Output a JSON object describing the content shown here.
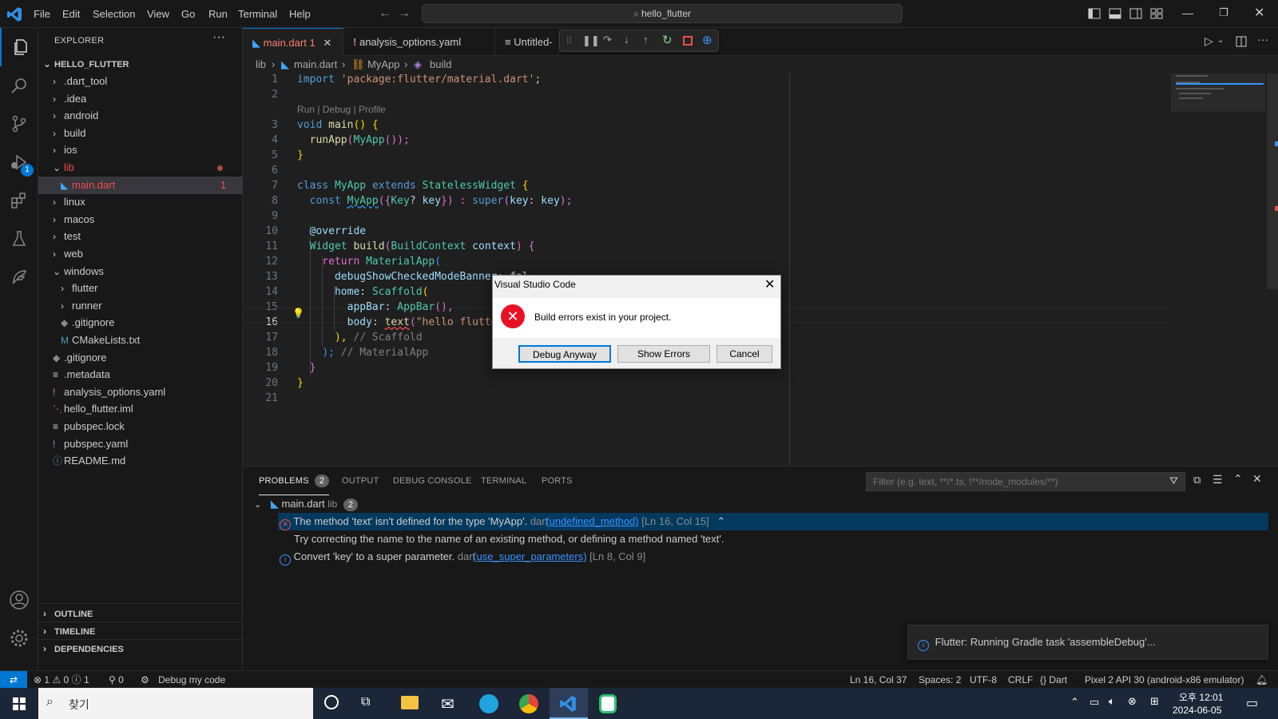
{
  "titlebar": {
    "menus": [
      "File",
      "Edit",
      "Selection",
      "View",
      "Go",
      "Run",
      "Terminal",
      "Help"
    ],
    "search": "hello_flutter"
  },
  "activity": {
    "debug_badge": "1"
  },
  "explorer": {
    "header": "EXPLORER",
    "root": "HELLO_FLUTTER",
    "items": [
      {
        "label": ".dart_tool",
        "indent": 0,
        "kind": "folder"
      },
      {
        "label": ".idea",
        "indent": 0,
        "kind": "folder"
      },
      {
        "label": "android",
        "indent": 0,
        "kind": "folder"
      },
      {
        "label": "build",
        "indent": 0,
        "kind": "folder"
      },
      {
        "label": "ios",
        "indent": 0,
        "kind": "folder"
      },
      {
        "label": "lib",
        "indent": 0,
        "kind": "folder-open"
      },
      {
        "label": "main.dart",
        "indent": 1,
        "kind": "dart"
      },
      {
        "label": "linux",
        "indent": 0,
        "kind": "folder"
      },
      {
        "label": "macos",
        "indent": 0,
        "kind": "folder"
      },
      {
        "label": "test",
        "indent": 0,
        "kind": "folder"
      },
      {
        "label": "web",
        "indent": 0,
        "kind": "folder"
      },
      {
        "label": "windows",
        "indent": 0,
        "kind": "folder-open"
      },
      {
        "label": "flutter",
        "indent": 1,
        "kind": "folder"
      },
      {
        "label": "runner",
        "indent": 1,
        "kind": "folder"
      },
      {
        "label": ".gitignore",
        "indent": 1,
        "kind": "git"
      },
      {
        "label": "CMakeLists.txt",
        "indent": 1,
        "kind": "cmake"
      },
      {
        "label": ".gitignore",
        "indent": 0,
        "kind": "git"
      },
      {
        "label": ".metadata",
        "indent": 0,
        "kind": "lines"
      },
      {
        "label": "analysis_options.yaml",
        "indent": 0,
        "kind": "yaml"
      },
      {
        "label": "hello_flutter.iml",
        "indent": 0,
        "kind": "rss"
      },
      {
        "label": "pubspec.lock",
        "indent": 0,
        "kind": "lines"
      },
      {
        "label": "pubspec.yaml",
        "indent": 0,
        "kind": "yaml"
      },
      {
        "label": "README.md",
        "indent": 0,
        "kind": "info"
      }
    ],
    "main_dart_badge": "1",
    "sections": [
      "OUTLINE",
      "TIMELINE",
      "DEPENDENCIES"
    ]
  },
  "tabs": [
    {
      "label": "main.dart",
      "badge": "1"
    },
    {
      "label": "analysis_options.yaml"
    },
    {
      "label": "Untitled-"
    }
  ],
  "breadcrumb": [
    "lib",
    "main.dart",
    "MyApp",
    "build"
  ],
  "codelens": "Run | Debug | Profile",
  "code_line_numbers": [
    "1",
    "2",
    "",
    "3",
    "4",
    "5",
    "6",
    "7",
    "8",
    "9",
    "10",
    "11",
    "12",
    "13",
    "14",
    "15",
    "16",
    "17",
    "18",
    "19",
    "20",
    "21"
  ],
  "code": {
    "l1a": "import ",
    "l1b": "'package:flutter/material.dart'",
    "l1c": ";",
    "l3a": "void ",
    "l3b": "main",
    "l3c": "() {",
    "l4a": "  ",
    "l4b": "runApp",
    "l4c": "(",
    "l4d": "MyApp",
    "l4e": "());",
    "l5": "}",
    "l7a": "class ",
    "l7b": "MyApp ",
    "l7c": "extends ",
    "l7d": "StatelessWidget ",
    "l7e": "{",
    "l8a": "  const ",
    "l8b": "MyApp",
    "l8c": "({",
    "l8d": "Key",
    "l8e": "? ",
    "l8f": "key",
    "l8g": "}) : ",
    "l8h": "super",
    "l8i": "(",
    "l8j": "key",
    "l8k": ": ",
    "l8l": "key",
    "l8m": ");",
    "l10": "  @override",
    "l11a": "  ",
    "l11b": "Widget ",
    "l11c": "build",
    "l11d": "(",
    "l11e": "BuildContext ",
    "l11f": "context",
    "l11g": ") {",
    "l12a": "    return ",
    "l12b": "MaterialApp",
    "l12c": "(",
    "l13a": "      ",
    "l13b": "debugShowCheckedModeBanner",
    "l13c": ": fal",
    "l14a": "      ",
    "l14b": "home",
    "l14c": ": ",
    "l14d": "Scaffold",
    "l14e": "(",
    "l15a": "        ",
    "l15b": "appBar",
    "l15c": ": ",
    "l15d": "AppBar",
    "l15e": "(),",
    "l16a": "        ",
    "l16b": "body",
    "l16c": ": ",
    "l16d": "text",
    "l16e": "(",
    "l16f": "\"hello flutte",
    "l17a": "      ",
    "l17b": "), ",
    "l17c": "// Scaffold",
    "l18a": "    ",
    "l18b": "); ",
    "l18c": "// MaterialApp",
    "l19": "  }",
    "l20": "}"
  },
  "panel": {
    "tabs": [
      "PROBLEMS",
      "OUTPUT",
      "DEBUG CONSOLE",
      "TERMINAL",
      "PORTS"
    ],
    "problems_count": "2",
    "filter_placeholder": "Filter (e.g. text, **/*.ts, !**/node_modules/**)",
    "file": "main.dart",
    "file_dir": "lib",
    "file_count": "2",
    "err1_msg": "The method 'text' isn't defined for the type 'MyApp'.",
    "err1_src": "dart",
    "err1_code": "(undefined_method)",
    "err1_loc": "[Ln 16, Col 15]",
    "err1_hint": "Try correcting the name to the name of an existing method, or defining a method named 'text'.",
    "info1_msg": "Convert 'key' to a super parameter.",
    "info1_src": "dart",
    "info1_code": "(use_super_parameters)",
    "info1_loc": "[Ln 8, Col 9]"
  },
  "dialog": {
    "title": "Visual Studio Code",
    "message": "Build errors exist in your project.",
    "debug_anyway": "Debug Anyway",
    "show_errors": "Show Errors",
    "cancel": "Cancel"
  },
  "notification": "Flutter: Running Gradle task 'assembleDebug'...",
  "status": {
    "errors": "1",
    "warnings": "0",
    "infos": "1",
    "ports": "0",
    "debug": "Debug my code",
    "position": "Ln 16, Col 37",
    "spaces": "Spaces: 2",
    "encoding": "UTF-8",
    "eol": "CRLF",
    "language": "Dart",
    "device": "Pixel 2 API 30 (android-x86 emulator)"
  },
  "taskbar": {
    "search": "찾기",
    "ampm": "오후 12:01",
    "date": "2024-06-05"
  },
  "colors": {
    "accent": "#0078d4",
    "error": "#f14c4c",
    "modified": "#e2c08d"
  }
}
